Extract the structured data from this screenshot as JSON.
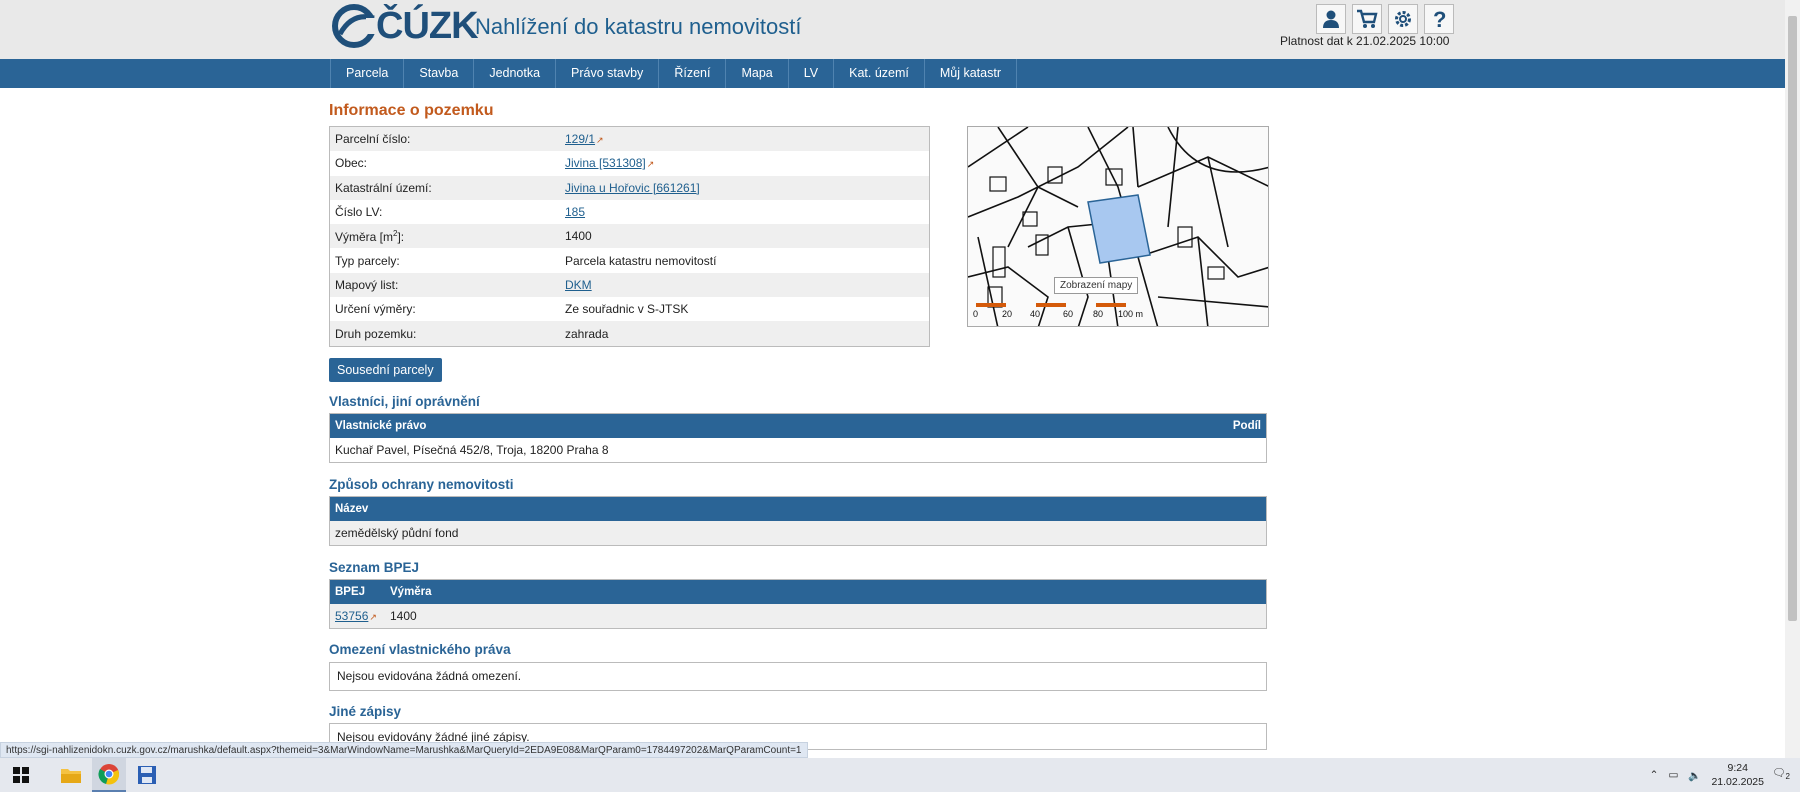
{
  "header": {
    "logo_text": "ČÚZK",
    "title": "Nahlížení do katastru nemovitostí",
    "validity": "Platnost dat k 21.02.2025 10:00",
    "icons": [
      "user-icon",
      "cart-icon",
      "gear-icon",
      "help-icon"
    ]
  },
  "nav": {
    "items": [
      "Parcela",
      "Stavba",
      "Jednotka",
      "Právo stavby",
      "Řízení",
      "Mapa",
      "LV",
      "Kat. území",
      "Můj katastr"
    ]
  },
  "info": {
    "heading": "Informace o pozemku",
    "rows": [
      {
        "label": "Parcelní číslo:",
        "value": "129/1"
      },
      {
        "label": "Obec:",
        "value": "Jivina [531308]"
      },
      {
        "label": "Katastrální území:",
        "value": "Jivina u Hořovic [661261]"
      },
      {
        "label": "Číslo LV:",
        "value": "185"
      },
      {
        "label": "Výměra [m",
        "sup": "2",
        "label_end": "]:",
        "value": "1400"
      },
      {
        "label": "Typ parcely:",
        "value": "Parcela katastru nemovitostí"
      },
      {
        "label": "Mapový list:",
        "value": "DKM"
      },
      {
        "label": "Určení výměry:",
        "value": "Ze souřadnic v S-JTSK"
      },
      {
        "label": "Druh pozemku:",
        "value": "zahrada"
      }
    ]
  },
  "map": {
    "tooltip": "Zobrazení mapy",
    "scale_labels": [
      "0",
      "20",
      "40",
      "60",
      "80",
      "100 m"
    ],
    "highlight_color": "#a8c8f0"
  },
  "neighbours_button": "Sousední parcely",
  "owners": {
    "title": "Vlastníci, jiní oprávnění",
    "col_left": "Vlastnické právo",
    "col_right": "Podíl",
    "row": "Kuchař Pavel, Písečná 452/8, Troja, 18200 Praha 8"
  },
  "protection": {
    "title": "Způsob ochrany nemovitosti",
    "col": "Název",
    "row": "zemědělský půdní fond"
  },
  "bpej": {
    "title": "Seznam BPEJ",
    "col1": "BPEJ",
    "col2": "Výměra",
    "code": "53756",
    "area": "1400"
  },
  "restrictions": {
    "title": "Omezení vlastnického práva",
    "text": "Nejsou evidována žádná omezení."
  },
  "other": {
    "title": "Jiné zápisy",
    "text": "Nejsou evidovány žádné jiné zápisy."
  },
  "status_url": "https://sgi-nahlizenidokn.cuzk.gov.cz/marushka/default.aspx?themeid=3&MarWindowName=Marushka&MarQueryId=2EDA9E08&MarQParam0=1784497202&MarQParamCount=1",
  "taskbar": {
    "time": "9:24",
    "date": "21.02.2025",
    "notif_count": "2"
  }
}
